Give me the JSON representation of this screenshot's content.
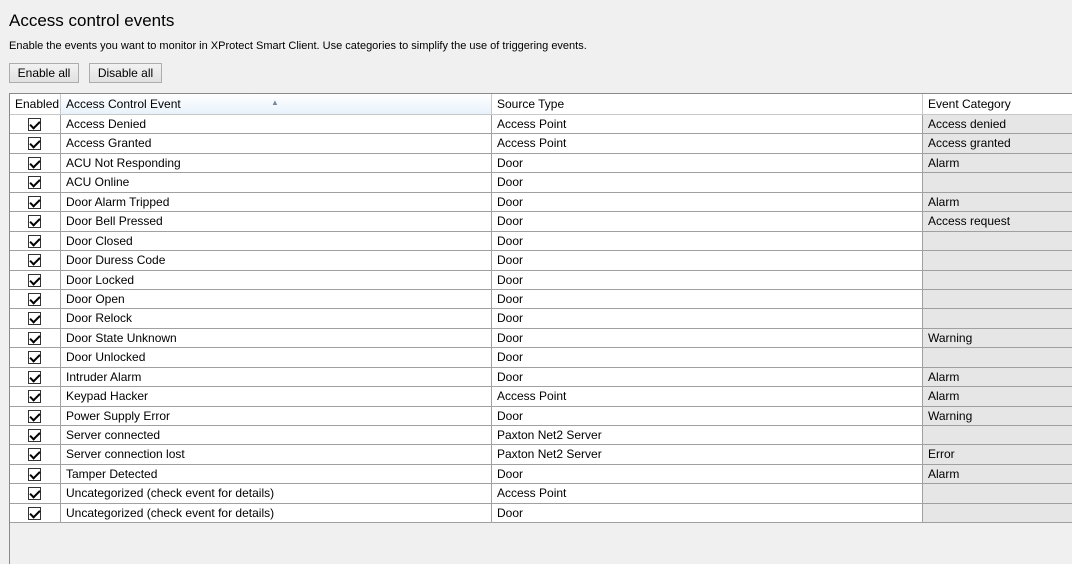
{
  "page": {
    "title": "Access control events",
    "description": "Enable the events you want to monitor in XProtect Smart Client. Use categories to simplify the use of triggering events."
  },
  "toolbar": {
    "enable_all": "Enable all",
    "disable_all": "Disable all"
  },
  "table": {
    "columns": [
      "Enabled",
      "Access Control Event",
      "Source Type",
      "Event Category"
    ],
    "rows": [
      {
        "enabled": true,
        "event": "Access Denied",
        "source": "Access Point",
        "category": "Access denied"
      },
      {
        "enabled": true,
        "event": "Access Granted",
        "source": "Access Point",
        "category": "Access granted"
      },
      {
        "enabled": true,
        "event": "ACU Not Responding",
        "source": "Door",
        "category": "Alarm"
      },
      {
        "enabled": true,
        "event": "ACU Online",
        "source": "Door",
        "category": ""
      },
      {
        "enabled": true,
        "event": "Door Alarm Tripped",
        "source": "Door",
        "category": "Alarm"
      },
      {
        "enabled": true,
        "event": "Door Bell Pressed",
        "source": "Door",
        "category": "Access request"
      },
      {
        "enabled": true,
        "event": "Door Closed",
        "source": "Door",
        "category": ""
      },
      {
        "enabled": true,
        "event": "Door Duress Code",
        "source": "Door",
        "category": ""
      },
      {
        "enabled": true,
        "event": "Door Locked",
        "source": "Door",
        "category": ""
      },
      {
        "enabled": true,
        "event": "Door Open",
        "source": "Door",
        "category": ""
      },
      {
        "enabled": true,
        "event": "Door Relock",
        "source": "Door",
        "category": ""
      },
      {
        "enabled": true,
        "event": "Door State Unknown",
        "source": "Door",
        "category": "Warning"
      },
      {
        "enabled": true,
        "event": "Door Unlocked",
        "source": "Door",
        "category": ""
      },
      {
        "enabled": true,
        "event": "Intruder Alarm",
        "source": "Door",
        "category": "Alarm"
      },
      {
        "enabled": true,
        "event": "Keypad Hacker",
        "source": "Access Point",
        "category": "Alarm"
      },
      {
        "enabled": true,
        "event": "Power Supply Error",
        "source": "Door",
        "category": "Warning"
      },
      {
        "enabled": true,
        "event": "Server connected",
        "source": "Paxton Net2 Server",
        "category": ""
      },
      {
        "enabled": true,
        "event": "Server connection lost",
        "source": "Paxton Net2 Server",
        "category": "Error"
      },
      {
        "enabled": true,
        "event": "Tamper Detected",
        "source": "Door",
        "category": "Alarm"
      },
      {
        "enabled": true,
        "event": "Uncategorized (check event for details)",
        "source": "Access Point",
        "category": ""
      },
      {
        "enabled": true,
        "event": "Uncategorized (check event for details)",
        "source": "Door",
        "category": ""
      }
    ]
  }
}
